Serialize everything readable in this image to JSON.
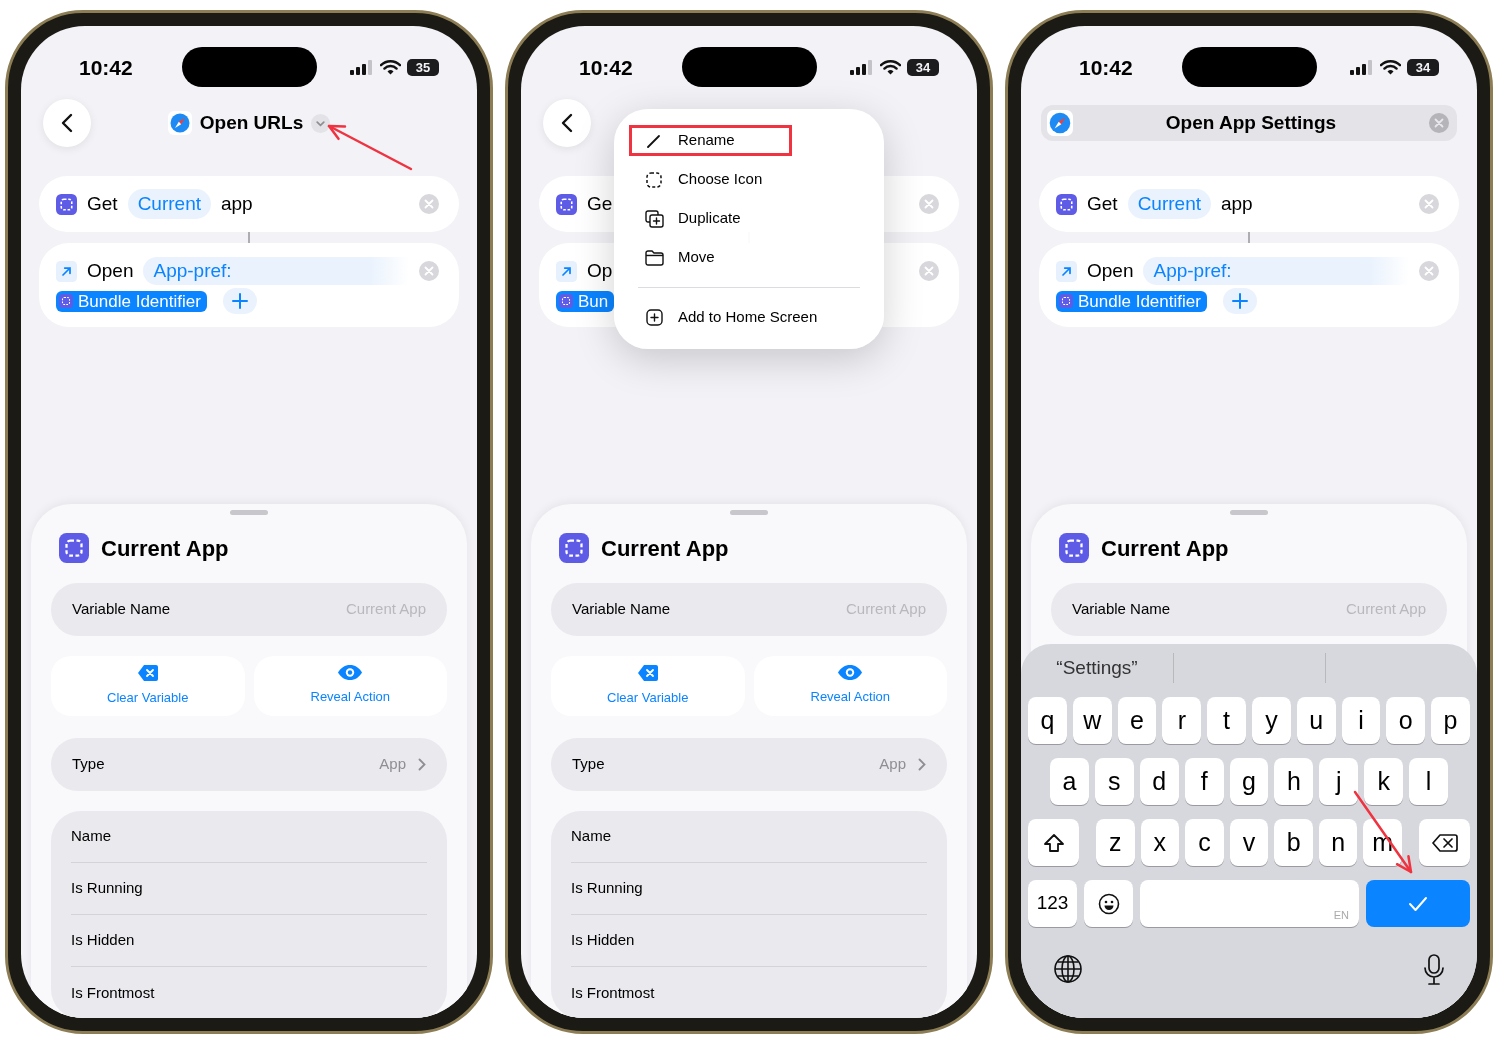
{
  "phones": [
    {
      "status": {
        "time": "10:42",
        "battery": "35"
      },
      "header": {
        "kind": "title",
        "title": "Open URLs"
      },
      "actions": [
        {
          "kind": "get",
          "parts": [
            {
              "kind": "word",
              "text": "Get"
            },
            {
              "kind": "token",
              "text": "Current"
            },
            {
              "kind": "word",
              "text": "app"
            }
          ]
        },
        {
          "kind": "open",
          "parts": [
            {
              "kind": "word",
              "text": "Open"
            },
            {
              "kind": "field",
              "text": "App-pref:"
            }
          ],
          "chip": "Bundle Identifier",
          "add_button": true
        }
      ],
      "sheet": {
        "title": "Current App",
        "variable": {
          "label": "Variable Name",
          "placeholder": "Current App"
        },
        "buttons": [
          {
            "kind": "clear",
            "label": "Clear Variable"
          },
          {
            "kind": "reveal",
            "label": "Reveal Action"
          }
        ],
        "type": {
          "label": "Type",
          "value": "App"
        },
        "properties": [
          "Name",
          "Is Running",
          "Is Hidden",
          "Is Frontmost"
        ]
      }
    },
    {
      "status": {
        "time": "10:42",
        "battery": "34"
      },
      "header": {
        "kind": "back_only"
      },
      "actions": [
        {
          "kind": "get",
          "parts": [
            {
              "kind": "word",
              "text": "Ge"
            }
          ]
        },
        {
          "kind": "open",
          "parts": [
            {
              "kind": "word",
              "text": "Op"
            }
          ],
          "chip": "Bun"
        }
      ],
      "menu": {
        "items": [
          {
            "kind": "rename",
            "label": "Rename",
            "highlighted": true
          },
          {
            "kind": "choose_icon",
            "label": "Choose Icon",
            "highlighted": false
          },
          {
            "kind": "duplicate",
            "label": "Duplicate",
            "highlighted": false
          },
          {
            "kind": "move",
            "label": "Move",
            "highlighted": false
          },
          {
            "kind": "add_home",
            "label": "Add to Home Screen",
            "highlighted": false,
            "divider_before": true
          }
        ]
      },
      "sheet": {
        "title": "Current App",
        "variable": {
          "label": "Variable Name",
          "placeholder": "Current App"
        },
        "buttons": [
          {
            "kind": "clear",
            "label": "Clear Variable"
          },
          {
            "kind": "reveal",
            "label": "Reveal Action"
          }
        ],
        "type": {
          "label": "Type",
          "value": "App"
        },
        "properties": [
          "Name",
          "Is Running",
          "Is Hidden",
          "Is Frontmost"
        ]
      }
    },
    {
      "status": {
        "time": "10:42",
        "battery": "34"
      },
      "header": {
        "kind": "field",
        "value": "Open App Settings"
      },
      "actions": [
        {
          "kind": "get",
          "parts": [
            {
              "kind": "word",
              "text": "Get"
            },
            {
              "kind": "token",
              "text": "Current"
            },
            {
              "kind": "word",
              "text": "app"
            }
          ]
        },
        {
          "kind": "open",
          "parts": [
            {
              "kind": "word",
              "text": "Open"
            },
            {
              "kind": "field",
              "text": "App-pref:"
            }
          ],
          "chip": "Bundle Identifier",
          "add_button": true
        }
      ],
      "sheet": {
        "title": "Current App",
        "variable": {
          "label": "Variable Name",
          "placeholder": "Current App"
        }
      },
      "keyboard": {
        "suggestions": [
          "“Settings”"
        ],
        "rows": [
          [
            "q",
            "w",
            "e",
            "r",
            "t",
            "y",
            "u",
            "i",
            "o",
            "p"
          ],
          [
            "a",
            "s",
            "d",
            "f",
            "g",
            "h",
            "j",
            "k",
            "l"
          ],
          [
            "z",
            "x",
            "c",
            "v",
            "b",
            "n",
            "m"
          ]
        ],
        "numbers_key": "123",
        "space_hint": "EN"
      }
    }
  ]
}
